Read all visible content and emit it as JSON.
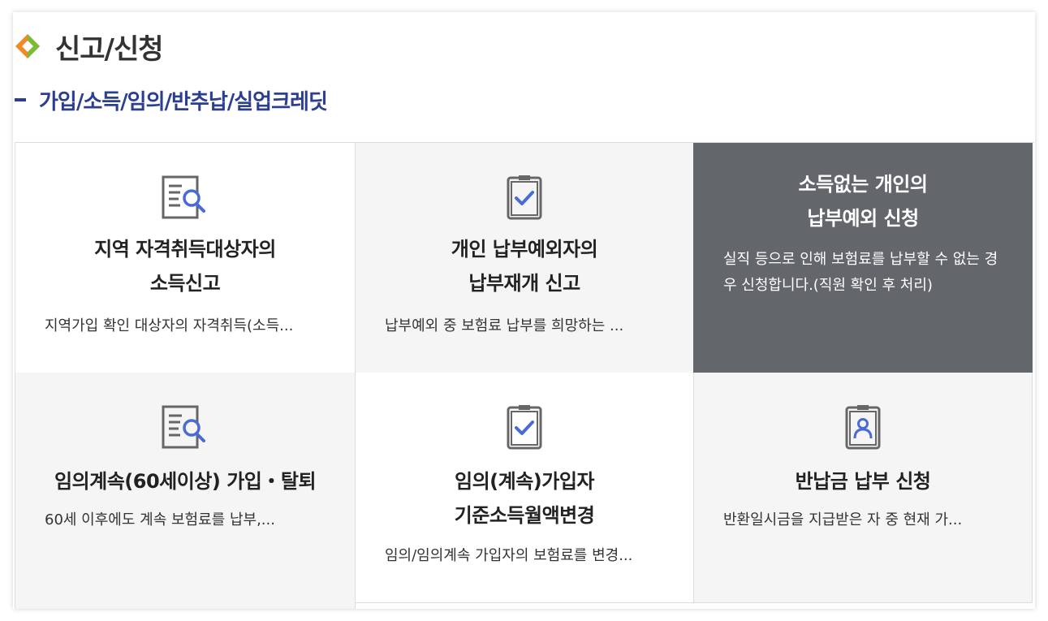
{
  "header": {
    "title": "신고/신청",
    "subtitle": "가입/소득/임의/반추납/실업크레딧"
  },
  "colors": {
    "accent_navy": "#2c3e8f",
    "card_dark": "#63666b",
    "card_gray": "#f5f5f5",
    "icon_blue": "#4a6bd6",
    "icon_gray": "#666666",
    "diamond_orange": "#f08a24",
    "diamond_green": "#7cbb37"
  },
  "cards": [
    {
      "icon": "document-search-icon",
      "title_line1": "지역 자격취득대상자의",
      "title_line2": "소득신고",
      "desc": "지역가입 확인 대상자의 자격취득(소득..."
    },
    {
      "icon": "clipboard-check-icon",
      "title_line1": "개인 납부예외자의",
      "title_line2": "납부재개 신고",
      "desc": "납부예외 중 보험료 납부를 희망하는 ..."
    },
    {
      "icon": "",
      "title_line1": "소득없는 개인의",
      "title_line2": "납부예외 신청",
      "desc": "실직 등으로 인해 보험료를 납부할 수 없는 경우 신청합니다.(직원 확인 후 처리)"
    },
    {
      "icon": "document-search-icon",
      "title_line1": "임의계속(60세이상) 가입・탈퇴",
      "title_line2": "",
      "desc": "60세 이후에도 계속 보험료를 납부,..."
    },
    {
      "icon": "clipboard-check-icon",
      "title_line1": "임의(계속)가입자",
      "title_line2": "기준소득월액변경",
      "desc": "임의/임의계속 가입자의 보험료를 변경..."
    },
    {
      "icon": "clipboard-person-icon",
      "title_line1": "반납금 납부 신청",
      "title_line2": "",
      "desc": "반환일시금을 지급받은 자 중 현재 가..."
    }
  ]
}
